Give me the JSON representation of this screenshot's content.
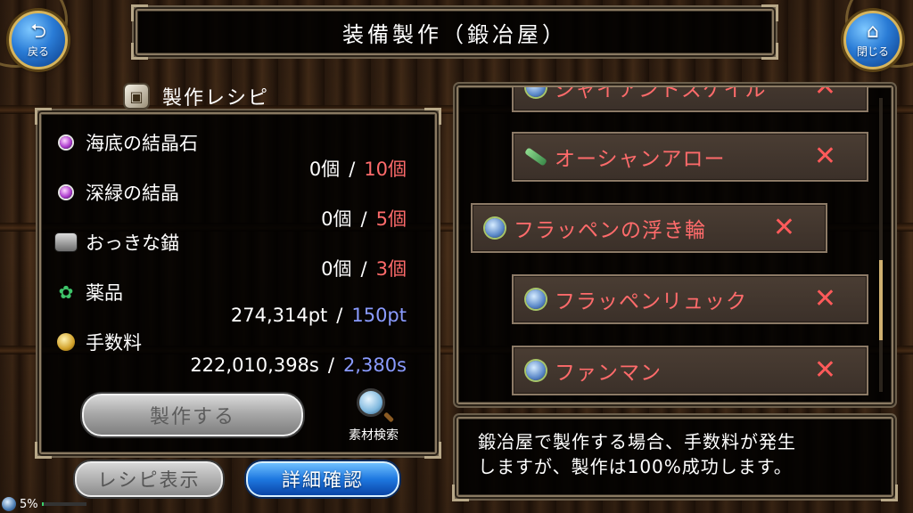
{
  "header": {
    "title": "装備製作（鍛冶屋）",
    "back_label": "戻る",
    "back_glyph": "⮌",
    "close_label": "閉じる",
    "close_glyph": "⌂"
  },
  "recipe": {
    "title": "製作レシピ",
    "title_icon": "box-icon",
    "materials": [
      {
        "name": "海底の結晶石",
        "icon": "crystal-orb-icon",
        "owned": "0個",
        "separator": "/",
        "required": "10個",
        "req_color": "#ff6b6b"
      },
      {
        "name": "深緑の結晶",
        "icon": "crystal-orb-icon",
        "owned": "0個",
        "separator": "/",
        "required": "5個",
        "req_color": "#ff6b6b"
      },
      {
        "name": "おっきな錨",
        "icon": "anchor-icon",
        "owned": "0個",
        "separator": "/",
        "required": "3個",
        "req_color": "#ff6b6b"
      },
      {
        "name": "薬品",
        "icon": "herb-icon",
        "owned": "274,314pt",
        "separator": "/",
        "required": "150pt",
        "req_color": "#8a9bff"
      },
      {
        "name": "手数料",
        "icon": "coin-icon",
        "owned": "222,010,398s",
        "separator": "/",
        "required": "2,380s",
        "req_color": "#8a9bff"
      }
    ],
    "craft_label": "製作する",
    "search_label": "素材検索"
  },
  "bottom_buttons": {
    "recipe_view_label": "レシピ表示",
    "detail_label": "詳細確認"
  },
  "item_list": {
    "items": [
      {
        "name": "ジャイアントスケイル",
        "icon": "float-ring-icon",
        "mark": "✕"
      },
      {
        "name": "オーシャンアロー",
        "icon": "arrow-icon",
        "mark": "✕"
      },
      {
        "name": "フラッペンの浮き輪",
        "icon": "float-ring-icon",
        "mark": "✕"
      },
      {
        "name": "フラッペンリュック",
        "icon": "float-ring-icon",
        "mark": "✕"
      },
      {
        "name": "ファンマン",
        "icon": "float-ring-icon",
        "mark": "✕"
      }
    ]
  },
  "message": {
    "text_line1": "鍛冶屋で製作する場合、手数料が発生",
    "text_line2": "しますが、製作は100%成功します。"
  },
  "gauge": {
    "percent_text": "5%",
    "percent_value": 5
  },
  "colors": {
    "required_shortage": "#ff6b6b",
    "required_ok": "#8a9bff",
    "list_item_text": "#ff6b6b",
    "accent_blue": "#1e78e0"
  }
}
